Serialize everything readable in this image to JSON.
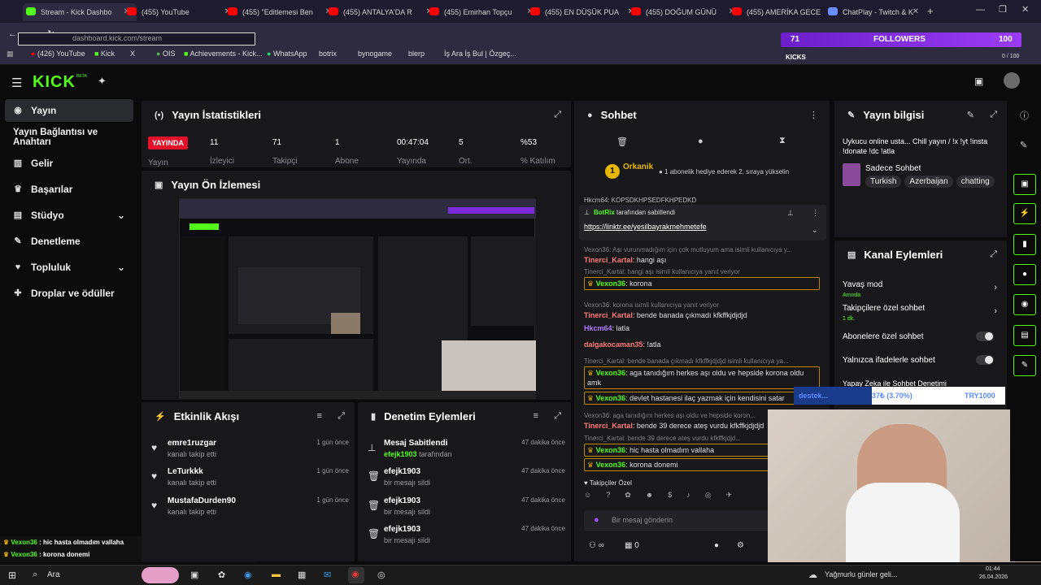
{
  "browser": {
    "tabs": [
      {
        "label": "Stream - Kick Dashbo",
        "active": true
      },
      {
        "label": "(455) YouTube"
      },
      {
        "label": "(455) \"Editlemesi Ben"
      },
      {
        "label": "(455) ANTALYA'DA R"
      },
      {
        "label": "(455) Emirhan Topçu"
      },
      {
        "label": "(455) EN DÜŞÜK PUA"
      },
      {
        "label": "(455) DOĞUM GÜNÜ"
      },
      {
        "label": "(455) AMERİKA GECE"
      },
      {
        "label": "ChatPlay - Twitch & K"
      }
    ],
    "url": "dashboard.kick.com/stream",
    "bookmarks": [
      "(426) YouTube",
      "Kick",
      "X",
      "OIS",
      "Achievements - Kick...",
      "WhatsApp",
      "botrix",
      "bynogame",
      "blerp",
      "İş Ara İş Bul | Özgeç..."
    ]
  },
  "overlay": {
    "followers_count": "71",
    "followers_label": "FOLLOWERS",
    "hundred": "100",
    "kicks_label": "KICKS",
    "kicks_value": "0 / 100",
    "progress_bar": "destek...",
    "progress_pct": "37₺ (3.70%)",
    "progress_goal": "TRY1000",
    "chat_overlay": [
      {
        "user": "Vexon36",
        "msg": "hic hasta olmadım vallaha"
      },
      {
        "user": "Vexon36",
        "msg": "korona donemi"
      }
    ]
  },
  "kick": {
    "logo": "KICK",
    "logo_sup": "BETA"
  },
  "sidebar": {
    "items": [
      {
        "label": "Yayın",
        "icon": "broadcast-icon"
      },
      {
        "label": "Yayın Bağlantısı ve Anahtarı",
        "icon": "key-icon"
      },
      {
        "label": "Gelir",
        "icon": "chart-icon"
      },
      {
        "label": "Başarılar",
        "icon": "trophy-icon"
      },
      {
        "label": "Stüdyo",
        "icon": "studio-icon"
      },
      {
        "label": "Denetleme",
        "icon": "wrench-icon"
      },
      {
        "label": "Topluluk",
        "icon": "community-icon"
      },
      {
        "label": "Droplar ve ödüller",
        "icon": "gift-icon"
      }
    ]
  },
  "stats": {
    "title": "Yayın İstatistikleri",
    "live_badge": "YAYINDA",
    "live_label": "Yayın",
    "items": [
      {
        "value": "11",
        "label": "İzleyici"
      },
      {
        "value": "71",
        "label": "Takipçi"
      },
      {
        "value": "1",
        "label": "Abone"
      },
      {
        "value": "00:47:04",
        "label": "Yayında"
      },
      {
        "value": "5",
        "label": "Ort."
      },
      {
        "value": "%53",
        "label": "% Katılım"
      }
    ]
  },
  "preview": {
    "title": "Yayın Ön İzlemesi"
  },
  "activity": {
    "title": "Etkinlik Akışı",
    "items": [
      {
        "name": "emre1ruzgar",
        "sub": "kanalı takip etti",
        "time": "1 gün önce"
      },
      {
        "name": "LeTurkkk",
        "sub": "kanalı takip etti",
        "time": "1 gün önce"
      },
      {
        "name": "MustafaDurden90",
        "sub": "kanalı takip etti",
        "time": "1 gün önce"
      }
    ]
  },
  "moderation": {
    "title": "Denetim Eylemleri",
    "items": [
      {
        "name": "Mesaj Sabitlendi",
        "sub_user": "efejk1903",
        "sub": "tarafından",
        "time": "47 dakika önce",
        "icon": "pin-icon"
      },
      {
        "name": "efejk1903",
        "sub": "bir mesajı sildi",
        "time": "47 dakika önce",
        "icon": "trash-icon"
      },
      {
        "name": "efejk1903",
        "sub": "bir mesajı sildi",
        "time": "47 dakika önce",
        "icon": "trash-icon"
      },
      {
        "name": "efejk1903",
        "sub": "bir mesajı sildi",
        "time": "47 dakika önce",
        "icon": "trash-icon"
      }
    ]
  },
  "chat": {
    "title": "Sohbet",
    "gifter": "Orkanik",
    "gifter_badge": "1",
    "gift_msg": "1 abonelik hediye ederek 2. sıraya yükselin",
    "scroll_line": "Hkcm64: KOPSDKHPSEDFKHPEDKD",
    "pinned_by": "BotRix",
    "pinned_suffix": "tarafından sabitlendi",
    "pinned_link": "https://linktr.ee/yesilbayrakmehmetefe",
    "messages": [
      {
        "reply": "Vexon36: Aşı vurunmadığım için çok mutluyum ama isimli kullanıcıya y...",
        "user": "Tinerci_Kartal",
        "text": ": hangi aşı",
        "color": "r"
      },
      {
        "reply": "Tinerci_Kartal: hangi aşı isimli kullanıcıya yanıt veriyor",
        "user": "Vexon36",
        "text": ": korona",
        "color": "g",
        "hl": true
      },
      {
        "reply": "Vexon36: korona isimli kullanıcıya yanıt veriyor",
        "user": "Tinerci_Kartal",
        "text": ": bende banada çıkmadı kfkffkjdjdjd",
        "color": "r"
      },
      {
        "user": "Hkcm64",
        "text": ": latla",
        "color": "p"
      },
      {
        "user": "dalgakocaman35",
        "text": ": !atla",
        "color": "r"
      },
      {
        "reply": "Tinerci_Kartal: bende banada çıkmadı kfkffkjdjdjd isimli kullanıcıya ya...",
        "user": "Vexon36",
        "text": ": aga tanıdığım herkes aşı oldu ve hepside korona oldu amk",
        "color": "g",
        "hl": true
      },
      {
        "user": "Vexon36",
        "text": ": devlet hastanesi ilaç yazmak için kendisini satar",
        "color": "g",
        "hl": true
      },
      {
        "reply": "Vexon36: aga tanıdığım herkes aşı oldu ve hepside koron...",
        "user": "Tinerci_Kartal",
        "text": ": bende 39 derece ateş vurdu kfkffkjdjdjd",
        "color": "r"
      },
      {
        "reply": "Tinerci_Kartal: bende 39 derece ateş vurdu kfkffkjdjd...",
        "user": "Vexon36",
        "text": ": hic hasta olmadım vallaha",
        "color": "g",
        "hl": true
      },
      {
        "user": "Vexon36",
        "text": ": korona donemi",
        "color": "g",
        "hl": true
      }
    ],
    "followers_only": "Takipçiler Özel",
    "input_placeholder": "Bir mesaj gönderin",
    "infinity": "∞",
    "gift_count": "0"
  },
  "info": {
    "title": "Yayın bilgisi",
    "stream_title": "Uykucu online usta... Chill yayın / !x !yt !insta !donate !dc !atla",
    "category": "Sadece Sohbet",
    "tags": [
      "Turkish",
      "Azerbaijan",
      "chatting"
    ]
  },
  "actions": {
    "title": "Kanal Eylemleri",
    "items": [
      {
        "label": "Yavaş mod",
        "sub": "Anında",
        "type": "arrow"
      },
      {
        "label": "Takipçilere özel sohbet",
        "sub": "1 dk.",
        "type": "arrow"
      },
      {
        "label": "Abonelere özel sohbet",
        "type": "toggle"
      },
      {
        "label": "Yalnızca ifadelerle sohbet",
        "type": "toggle"
      },
      {
        "label": "Yapay Zeka ile Sohbet Denetimi",
        "type": "link"
      }
    ]
  },
  "taskbar": {
    "search": "Ara",
    "weather": "Yağmurlu günler geli...",
    "time": "01:44",
    "date": "26.04.2026"
  },
  "colors": {
    "kick_green": "#53fc18",
    "live_red": "#e3102a",
    "panel": "#18181b"
  }
}
